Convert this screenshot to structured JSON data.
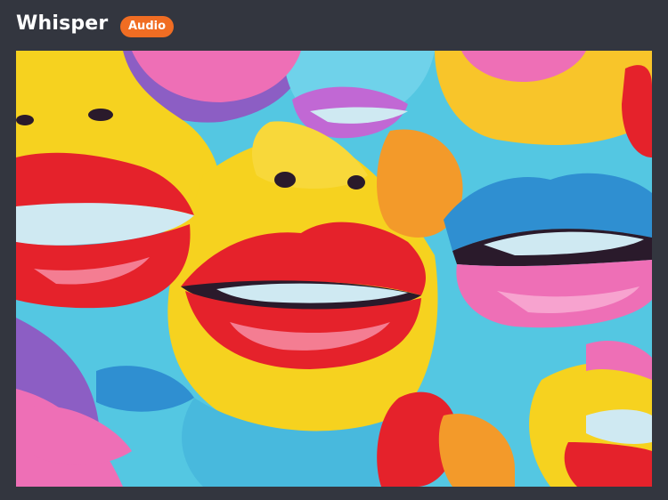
{
  "header": {
    "title": "Whisper",
    "badge": "Audio"
  },
  "artwork": {
    "icon": "pop-art-lips-image",
    "colors": {
      "sky": "#54c7e2",
      "yellow": "#f6d21f",
      "red": "#e5222b",
      "pink": "#ee6fb6",
      "blue": "#2f8fd1",
      "purple": "#8c5ec4",
      "teeth": "#cfe9f2",
      "mouth": "#2a1a2b",
      "orange": "#f39a2a"
    }
  }
}
